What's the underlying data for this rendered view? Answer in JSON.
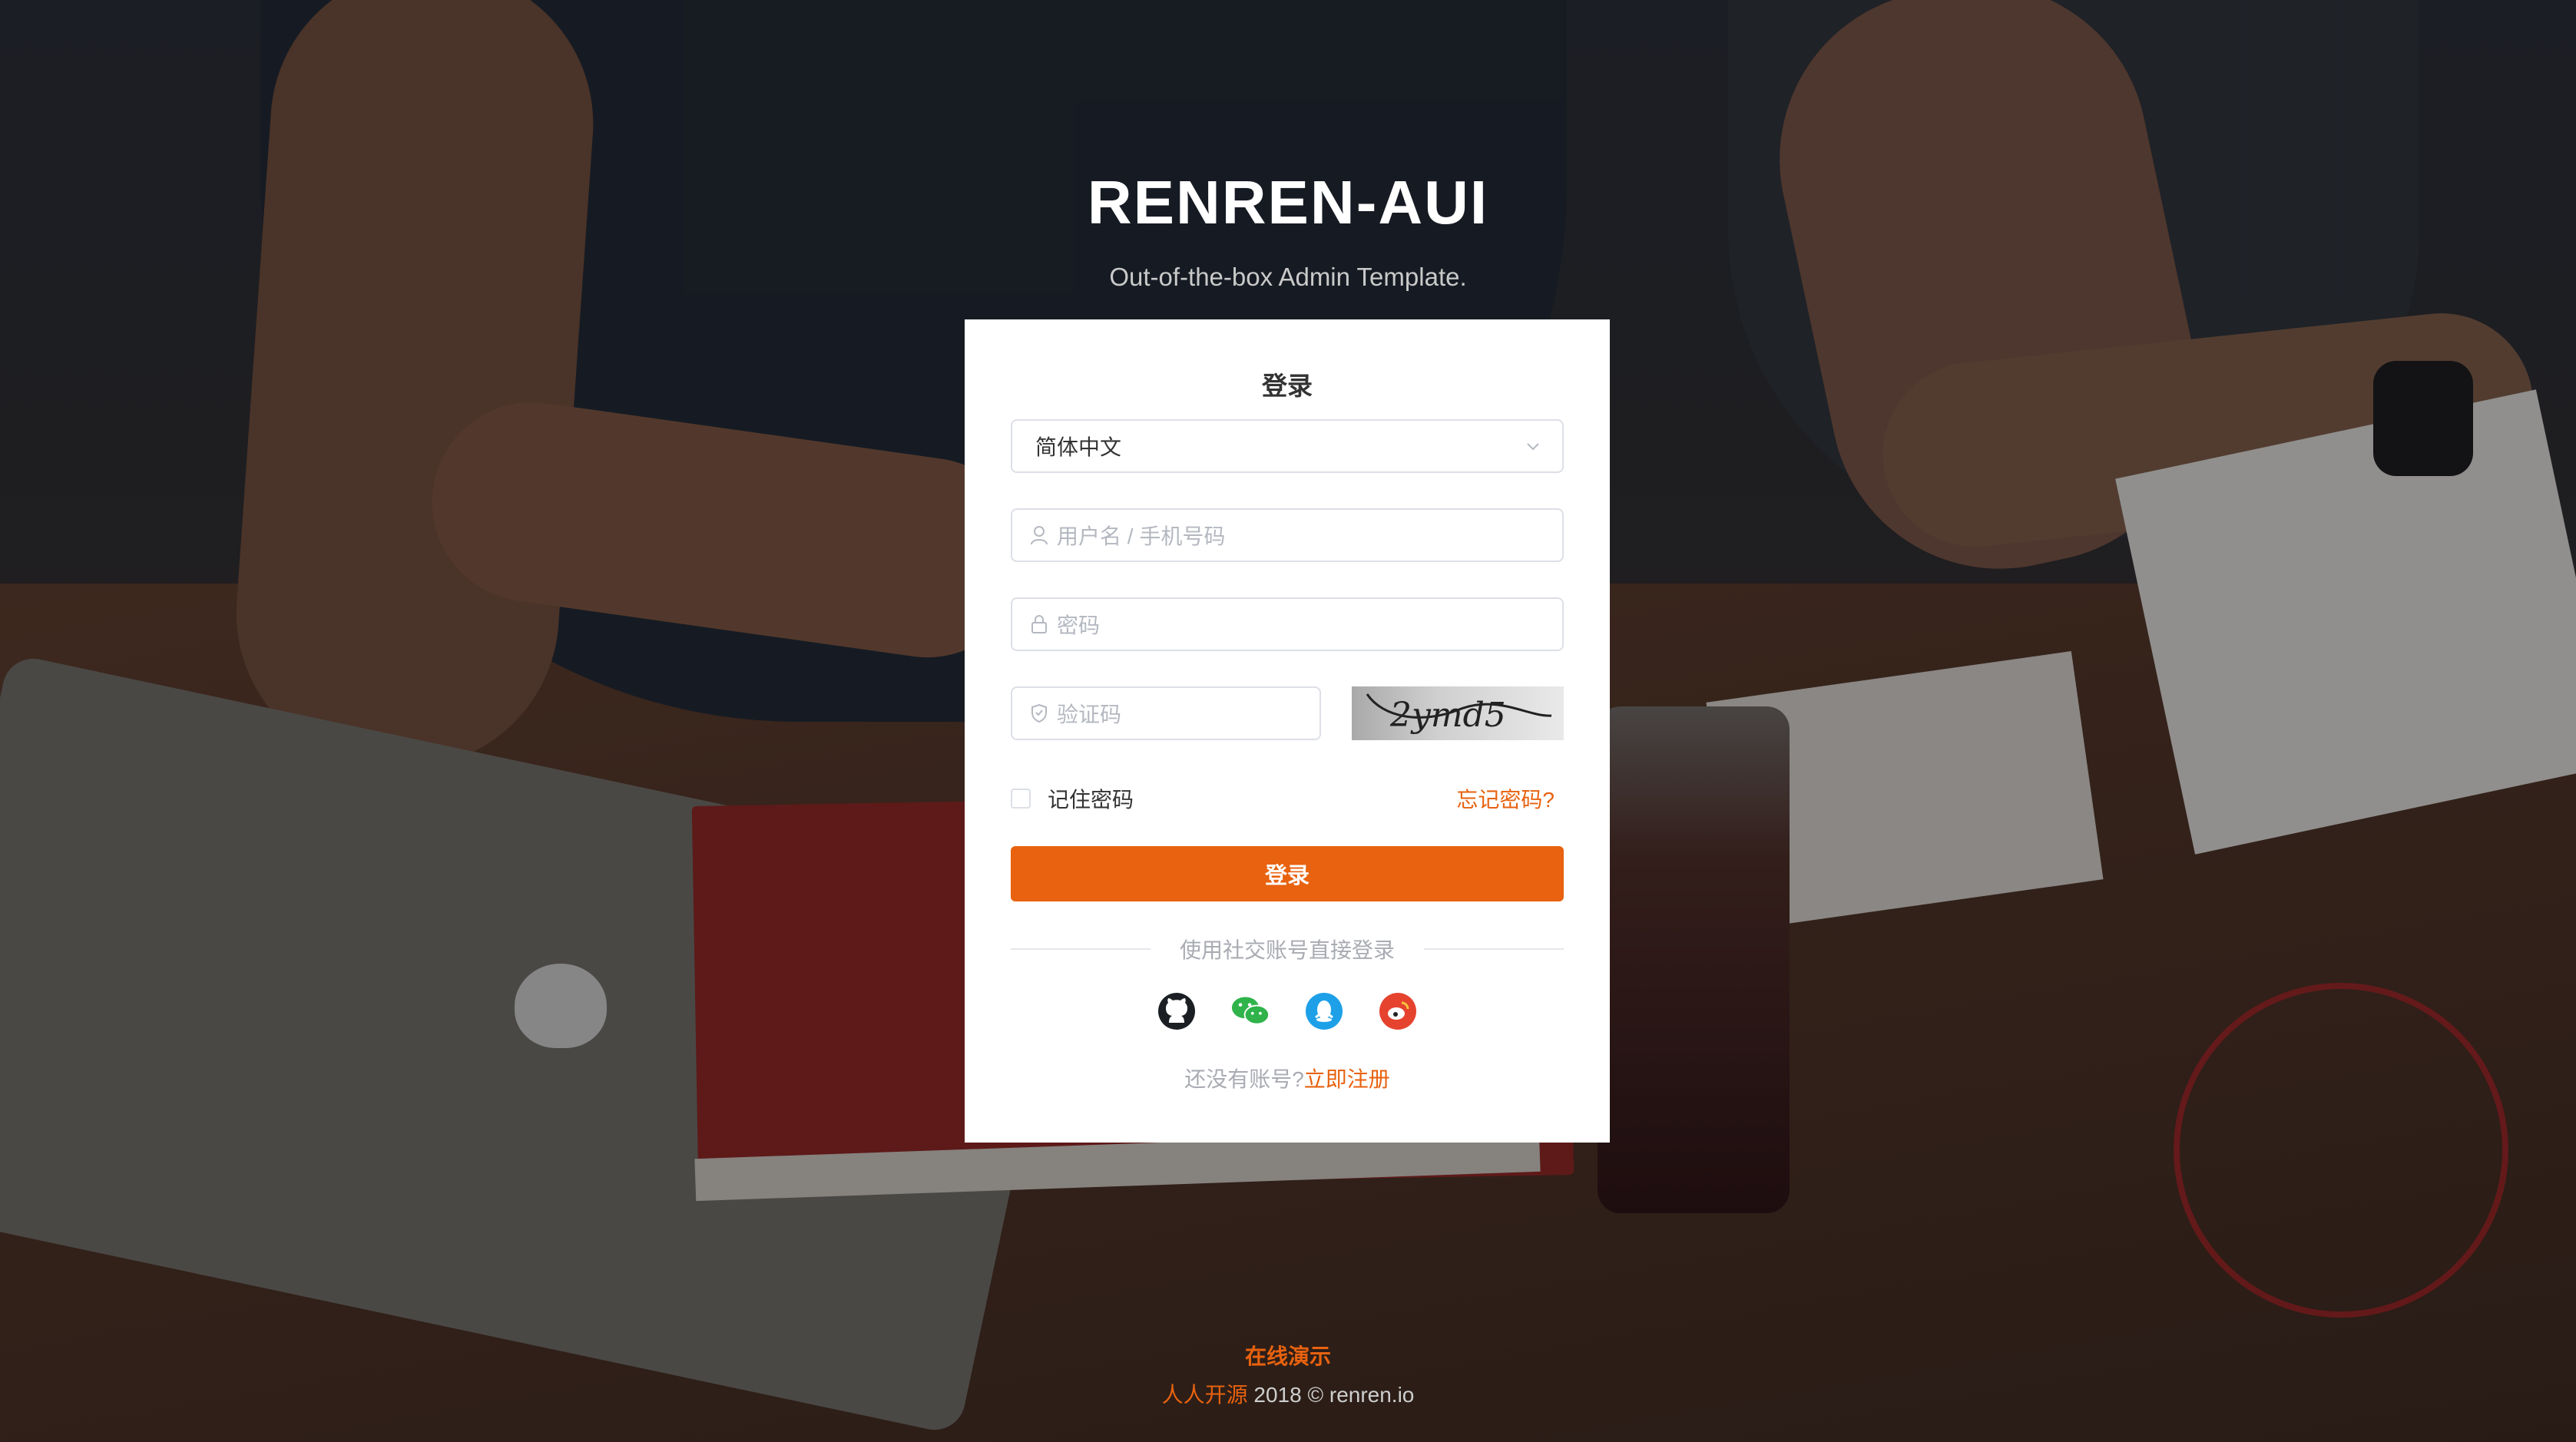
{
  "header": {
    "title": "RENREN-AUI",
    "subtitle": "Out-of-the-box Admin Template."
  },
  "login": {
    "title": "登录",
    "language_select": {
      "value": "简体中文"
    },
    "username": {
      "placeholder": "用户名 / 手机号码"
    },
    "password": {
      "placeholder": "密码"
    },
    "captcha": {
      "placeholder": "验证码",
      "image_text": "2ymd5"
    },
    "remember_label": "记住密码",
    "forgot_link": "忘记密码?",
    "submit_label": "登录",
    "social_divider": "使用社交账号直接登录",
    "social_icons": [
      "github-icon",
      "wechat-icon",
      "qq-icon",
      "weibo-icon"
    ],
    "signup_question": "还没有账号?",
    "signup_link": "立即注册"
  },
  "footer": {
    "demo_link": "在线演示",
    "brand": "人人开源",
    "copyright": " 2018 © renren.io"
  },
  "colors": {
    "accent": "#e8620f",
    "card_bg": "#ffffff",
    "title_text": "#ffffff"
  }
}
